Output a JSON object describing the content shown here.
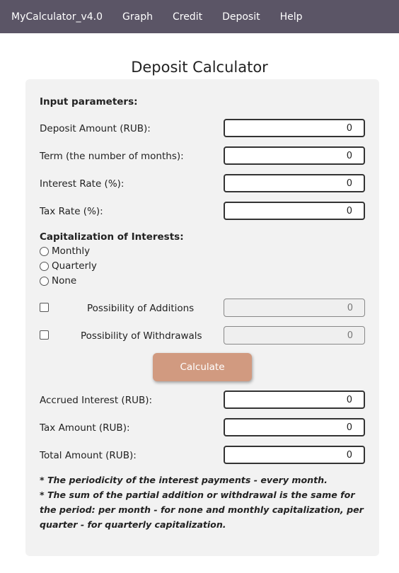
{
  "navbar": {
    "brand": "MyCalculator_v4.0",
    "items": [
      "Graph",
      "Credit",
      "Deposit",
      "Help"
    ]
  },
  "page_title": "Deposit Calculator",
  "inputs": {
    "heading": "Input parameters:",
    "deposit_amount": {
      "label": "Deposit Amount (RUB):",
      "value": "0"
    },
    "term": {
      "label": "Term (the number of months):",
      "value": "0"
    },
    "interest_rate": {
      "label": "Interest Rate (%):",
      "value": "0"
    },
    "tax_rate": {
      "label": "Tax Rate (%):",
      "value": "0"
    }
  },
  "capitalization": {
    "heading": "Capitalization of Interests:",
    "options": [
      "Monthly",
      "Quarterly",
      "None"
    ]
  },
  "additions": {
    "label": "Possibility of Additions",
    "value": "0"
  },
  "withdrawals": {
    "label": "Possibility of Withdrawals",
    "value": "0"
  },
  "calculate_label": "Calculate",
  "outputs": {
    "accrued_interest": {
      "label": "Accrued Interest (RUB):",
      "value": "0"
    },
    "tax_amount": {
      "label": "Tax Amount (RUB):",
      "value": "0"
    },
    "total_amount": {
      "label": "Total Amount (RUB):",
      "value": "0"
    }
  },
  "notes": [
    "* The periodicity of the interest payments - every month.",
    "* The sum of the partial addition or withdrawal is the same for the period: per month - for none and monthly capitalization, per quarter - for quarterly capitalization."
  ],
  "colors": {
    "navbar": "#5b5566",
    "panel": "#f2f2f2",
    "button": "#d19a80"
  }
}
